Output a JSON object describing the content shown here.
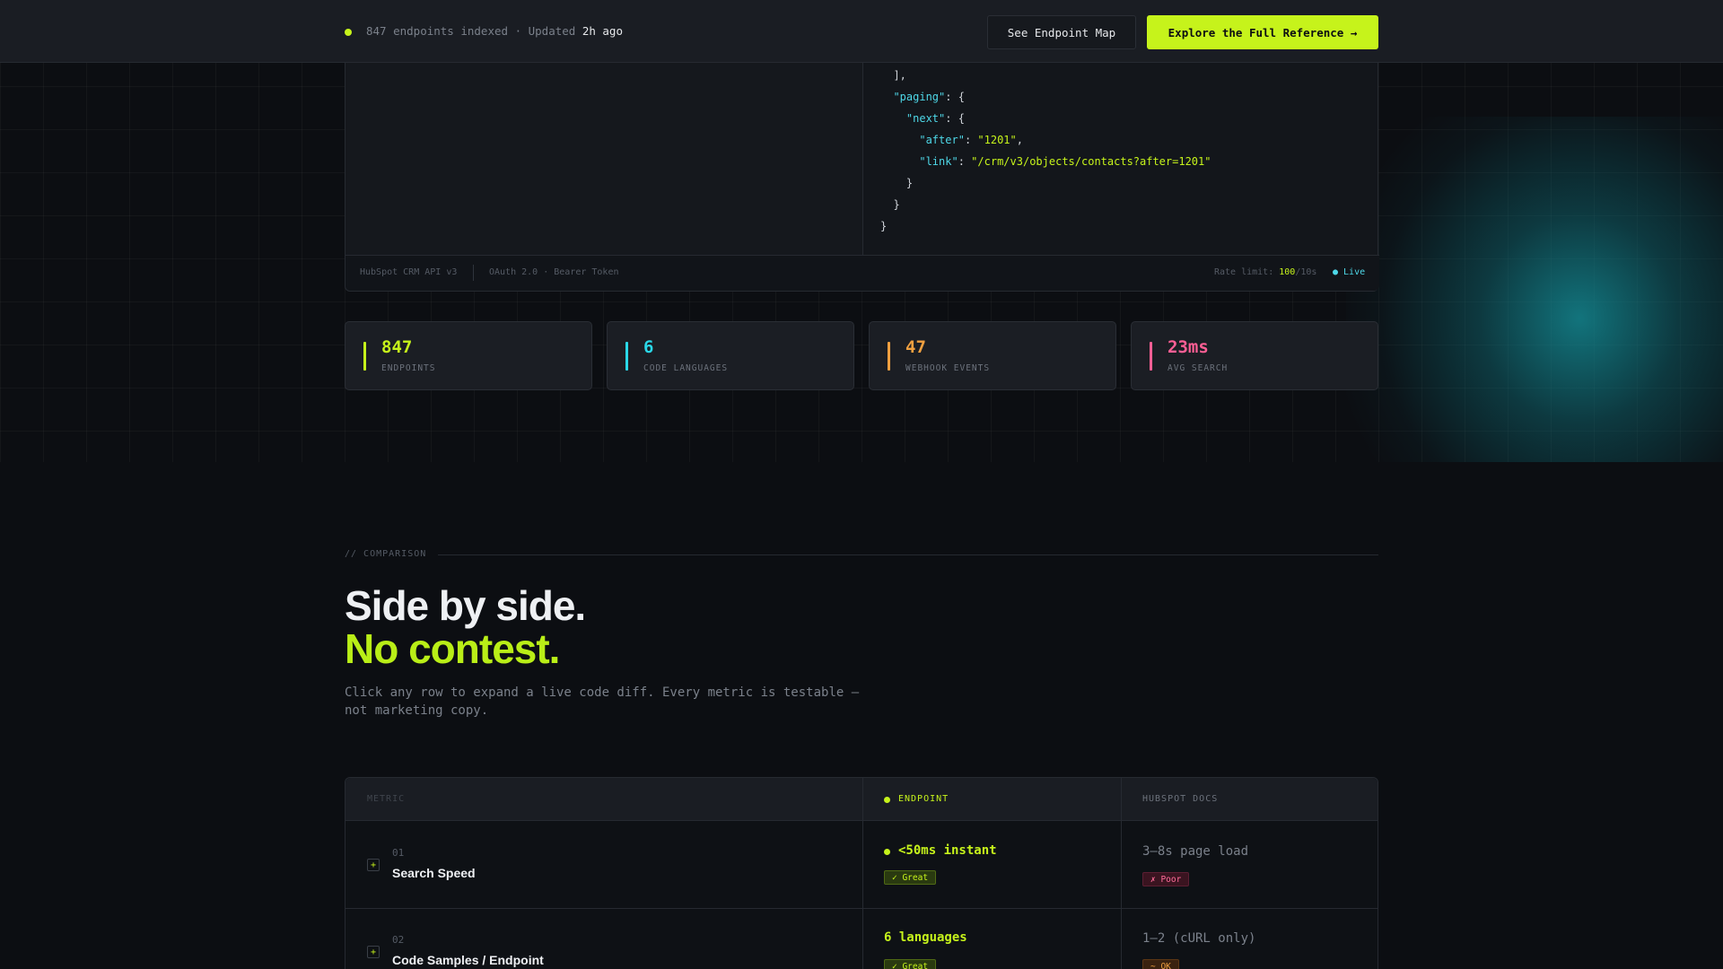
{
  "topbar": {
    "status_text": "847 endpoints indexed · Updated ",
    "status_time": "2h ago",
    "map_button": "See Endpoint Map",
    "explore_button": "Explore the Full Reference →"
  },
  "code_lines": [
    "  ],",
    "  \"paging\": {",
    "    \"next\": {",
    "      \"after\": \"1201\",",
    "      \"link\": \"/crm/v3/objects/contacts?after=1201\"",
    "    }",
    "  }",
    "}"
  ],
  "panel_footer": {
    "api": "HubSpot CRM API v3",
    "auth": "OAuth 2.0 · Bearer Token",
    "rate_label": "Rate limit: ",
    "rate_value": "100",
    "rate_unit": "/10s",
    "live": "● Live"
  },
  "stats": [
    {
      "value": "847",
      "label": "ENDPOINTS",
      "color": "#c6f31b"
    },
    {
      "value": "6",
      "label": "CODE LANGUAGES",
      "color": "#2ad8e8"
    },
    {
      "value": "47",
      "label": "WEBHOOK EVENTS",
      "color": "#f0a040"
    },
    {
      "value": "23ms",
      "label": "AVG SEARCH",
      "color": "#ff5f95"
    }
  ],
  "comparison": {
    "label": "// COMPARISON",
    "heading_line1": "Side by side.",
    "heading_line2": "No contest.",
    "description": "Click any row to expand a live code diff. Every metric is testable — not marketing copy."
  },
  "table": {
    "headers": {
      "metric": "METRIC",
      "endpoint": "ENDPOINT",
      "hubspot": "HUBSPOT DOCS"
    },
    "rows": [
      {
        "num": "01",
        "title": "Search Speed",
        "endpoint_value": "<50ms instant",
        "endpoint_badge": "✓ Great",
        "hubspot_value": "3–8s page load",
        "hubspot_badge": "✗ Poor"
      },
      {
        "num": "02",
        "title": "Code Samples / Endpoint",
        "endpoint_value": "6 languages",
        "endpoint_badge": "✓ Great",
        "hubspot_value": "1–2 (cURL only)",
        "hubspot_badge": "~ OK"
      }
    ]
  },
  "colors": {
    "accent": "#c6f31b",
    "cyan": "#2ad8e8",
    "orange": "#f0a040",
    "pink": "#ff5f95"
  }
}
